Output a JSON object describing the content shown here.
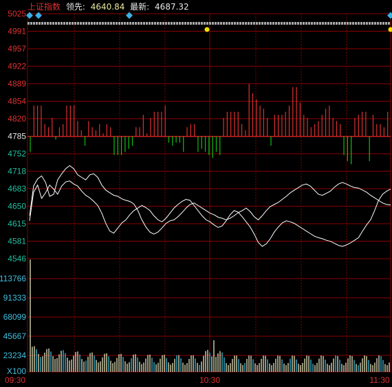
{
  "header": {
    "index_name": "上证指数",
    "lead_label": "领先:",
    "lead_value": "4640.84",
    "latest_label": "最新:",
    "latest_value": "4687.32"
  },
  "colors": {
    "background": "#000000",
    "grid": "#8b0000",
    "up_axis_text": "#e03030",
    "down_axis_text": "#20c0a0",
    "volume_axis_text": "#40c0e0",
    "time_text": "#e03030",
    "up_bar": "#e03030",
    "down_bar": "#10c010",
    "volume_bar": "#e8e8c0",
    "volume_bar_alt": "#40c0e0",
    "price_line": "#ffffff",
    "event_marker_diamond": "#3ab0e8",
    "event_marker_dot": "#f0e000",
    "event_strip": "#a8a8a8"
  },
  "chart_data": {
    "type": "line",
    "price_axis": {
      "ticks": [
        5025,
        4991,
        4957,
        4922,
        4889,
        4854,
        4820,
        4785,
        4752,
        4718,
        4683,
        4650,
        4615,
        4581,
        4546
      ],
      "ylim": [
        4546,
        5025
      ],
      "base": 4785
    },
    "volume_axis": {
      "ticks": [
        113766,
        91333,
        68099,
        45667,
        23234
      ],
      "unit_label": "X100",
      "ylim": [
        0,
        136000
      ]
    },
    "time_labels": [
      "09:30",
      "10:30",
      "11:30"
    ],
    "series": [
      {
        "values": [
          4630,
          4688,
          4702,
          4708,
          4695,
          4668,
          4672,
          4700,
          4712,
          4722,
          4728,
          4722,
          4710,
          4705,
          4700,
          4710,
          4712,
          4705,
          4690,
          4680,
          4675,
          4670,
          4668,
          4663,
          4660,
          4658,
          4653,
          4640,
          4622,
          4608,
          4598,
          4594,
          4598,
          4606,
          4615,
          4620,
          4622,
          4628,
          4636,
          4645,
          4652,
          4655,
          4650,
          4645,
          4640,
          4635,
          4632,
          4627,
          4625,
          4622,
          4625,
          4630,
          4636,
          4640,
          4645,
          4638,
          4628,
          4622,
          4630,
          4640,
          4648,
          4652,
          4656,
          4662,
          4668,
          4675,
          4680,
          4685,
          4690,
          4692,
          4688,
          4680,
          4672,
          4670,
          4674,
          4678,
          4686,
          4692,
          4695,
          4692,
          4688,
          4685,
          4684,
          4680,
          4676,
          4670,
          4665,
          4660,
          4655,
          4652,
          4651
        ]
      },
      {
        "values": [
          4620,
          4676,
          4690,
          4664,
          4675,
          4690,
          4682,
          4672,
          4688,
          4696,
          4698,
          4692,
          4688,
          4678,
          4670,
          4665,
          4658,
          4650,
          4635,
          4615,
          4600,
          4596,
          4606,
          4616,
          4622,
          4632,
          4640,
          4645,
          4650,
          4646,
          4640,
          4630,
          4622,
          4618,
          4625,
          4635,
          4645,
          4652,
          4658,
          4662,
          4660,
          4650,
          4640,
          4630,
          4622,
          4618,
          4612,
          4607,
          4610,
          4620,
          4632,
          4640,
          4637,
          4628,
          4618,
          4608,
          4594,
          4578,
          4570,
          4575,
          4585,
          4598,
          4608,
          4616,
          4620,
          4618,
          4615,
          4610,
          4605,
          4600,
          4595,
          4590,
          4587,
          4585,
          4582,
          4580,
          4576,
          4572,
          4570,
          4573,
          4577,
          4582,
          4587,
          4600,
          4612,
          4622,
          4640,
          4660,
          4672,
          4678,
          4682
        ]
      }
    ],
    "upper_bars": [
      -25,
      50,
      50,
      50,
      20,
      15,
      30,
      -5,
      15,
      20,
      50,
      50,
      50,
      25,
      10,
      -15,
      25,
      15,
      10,
      20,
      5,
      20,
      15,
      -30,
      -30,
      -30,
      -25,
      -20,
      -15,
      15,
      15,
      35,
      5,
      30,
      40,
      40,
      40,
      50,
      -10,
      -15,
      -10,
      -10,
      -25,
      15,
      20,
      20,
      -25,
      -20,
      -25,
      -30,
      -35,
      -25,
      -30,
      30,
      40,
      40,
      40,
      40,
      20,
      10,
      85,
      70,
      60,
      50,
      45,
      30,
      -15,
      35,
      35,
      35,
      40,
      50,
      80,
      80,
      55,
      35,
      30,
      15,
      20,
      25,
      35,
      45,
      50,
      30,
      25,
      20,
      -30,
      -40,
      -45,
      30,
      35,
      40,
      40,
      -40,
      35,
      20,
      20,
      15,
      40
    ]
  }
}
